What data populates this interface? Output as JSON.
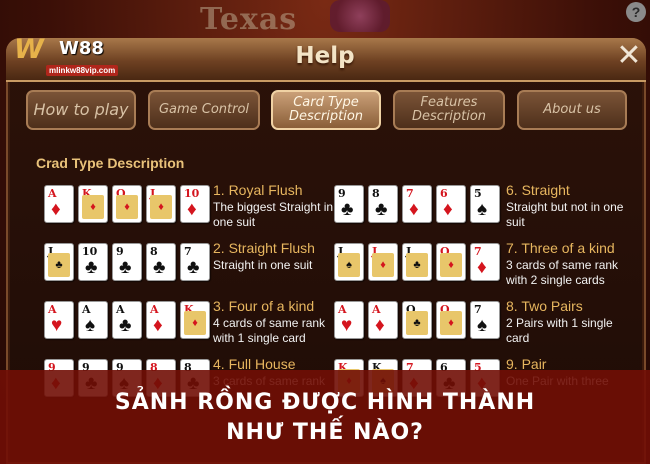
{
  "background": {
    "title": "Texas"
  },
  "logo": {
    "mark": "W",
    "text": "W88",
    "url": "mlinkw88vip.com"
  },
  "header": {
    "title": "Help",
    "close_glyph": "✕"
  },
  "tabs": [
    {
      "label": "How to play",
      "active": false
    },
    {
      "label": "Game Control",
      "active": false
    },
    {
      "label": "Card Type Description",
      "active": true
    },
    {
      "label": "Features Description",
      "active": false
    },
    {
      "label": "About us",
      "active": false
    }
  ],
  "section": {
    "title": "Crad Type Description"
  },
  "hands": [
    {
      "name": "1. Royal Flush",
      "desc": "The biggest Straight in one suit",
      "cards": [
        [
          "A",
          "♦",
          "red"
        ],
        [
          "K",
          "♦",
          "red"
        ],
        [
          "Q",
          "♦",
          "red"
        ],
        [
          "J",
          "♦",
          "red"
        ],
        [
          "10",
          "♦",
          "red"
        ]
      ]
    },
    {
      "name": "6. Straight",
      "desc": "Straight but not in one suit",
      "cards": [
        [
          "9",
          "♣",
          "black"
        ],
        [
          "8",
          "♣",
          "black"
        ],
        [
          "7",
          "♦",
          "red"
        ],
        [
          "6",
          "♦",
          "red"
        ],
        [
          "5",
          "♠",
          "black"
        ]
      ]
    },
    {
      "name": "2. Straight Flush",
      "desc": "Straight in one suit",
      "cards": [
        [
          "J",
          "♣",
          "black"
        ],
        [
          "10",
          "♣",
          "black"
        ],
        [
          "9",
          "♣",
          "black"
        ],
        [
          "8",
          "♣",
          "black"
        ],
        [
          "7",
          "♣",
          "black"
        ]
      ]
    },
    {
      "name": "7. Three of a kind",
      "desc": "3 cards of same rank with 2 single cards",
      "cards": [
        [
          "J",
          "♠",
          "black"
        ],
        [
          "J",
          "♦",
          "red"
        ],
        [
          "J",
          "♣",
          "black"
        ],
        [
          "Q",
          "♦",
          "red"
        ],
        [
          "7",
          "♦",
          "red"
        ]
      ]
    },
    {
      "name": "3. Four of a kind",
      "desc": "4 cards of same rank with 1 single card",
      "cards": [
        [
          "A",
          "♥",
          "red"
        ],
        [
          "A",
          "♠",
          "black"
        ],
        [
          "A",
          "♣",
          "black"
        ],
        [
          "A",
          "♦",
          "red"
        ],
        [
          "K",
          "♦",
          "red"
        ]
      ]
    },
    {
      "name": "8. Two Pairs",
      "desc": "2 Pairs with 1 single card",
      "cards": [
        [
          "A",
          "♥",
          "red"
        ],
        [
          "A",
          "♦",
          "red"
        ],
        [
          "Q",
          "♣",
          "black"
        ],
        [
          "Q",
          "♦",
          "red"
        ],
        [
          "7",
          "♠",
          "black"
        ]
      ]
    },
    {
      "name": "4. Full House",
      "desc": "3 cards of same rank",
      "cards": [
        [
          "9",
          "♦",
          "red"
        ],
        [
          "9",
          "♣",
          "black"
        ],
        [
          "9",
          "♠",
          "black"
        ],
        [
          "8",
          "♦",
          "red"
        ],
        [
          "8",
          "♣",
          "black"
        ]
      ]
    },
    {
      "name": "9. Pair",
      "desc": "One Pair with three",
      "cards": [
        [
          "K",
          "♦",
          "red"
        ],
        [
          "K",
          "♠",
          "black"
        ],
        [
          "7",
          "♦",
          "red"
        ],
        [
          "6",
          "♣",
          "black"
        ],
        [
          "5",
          "♦",
          "red"
        ]
      ]
    }
  ],
  "banner": {
    "line1": "SẢNH RỒNG ĐƯỢC HÌNH THÀNH",
    "line2": "NHƯ THẾ NÀO?"
  },
  "colors": {
    "accent_gold": "#e9c27a",
    "banner_red": "#710e06",
    "card_red": "#d4151e"
  }
}
